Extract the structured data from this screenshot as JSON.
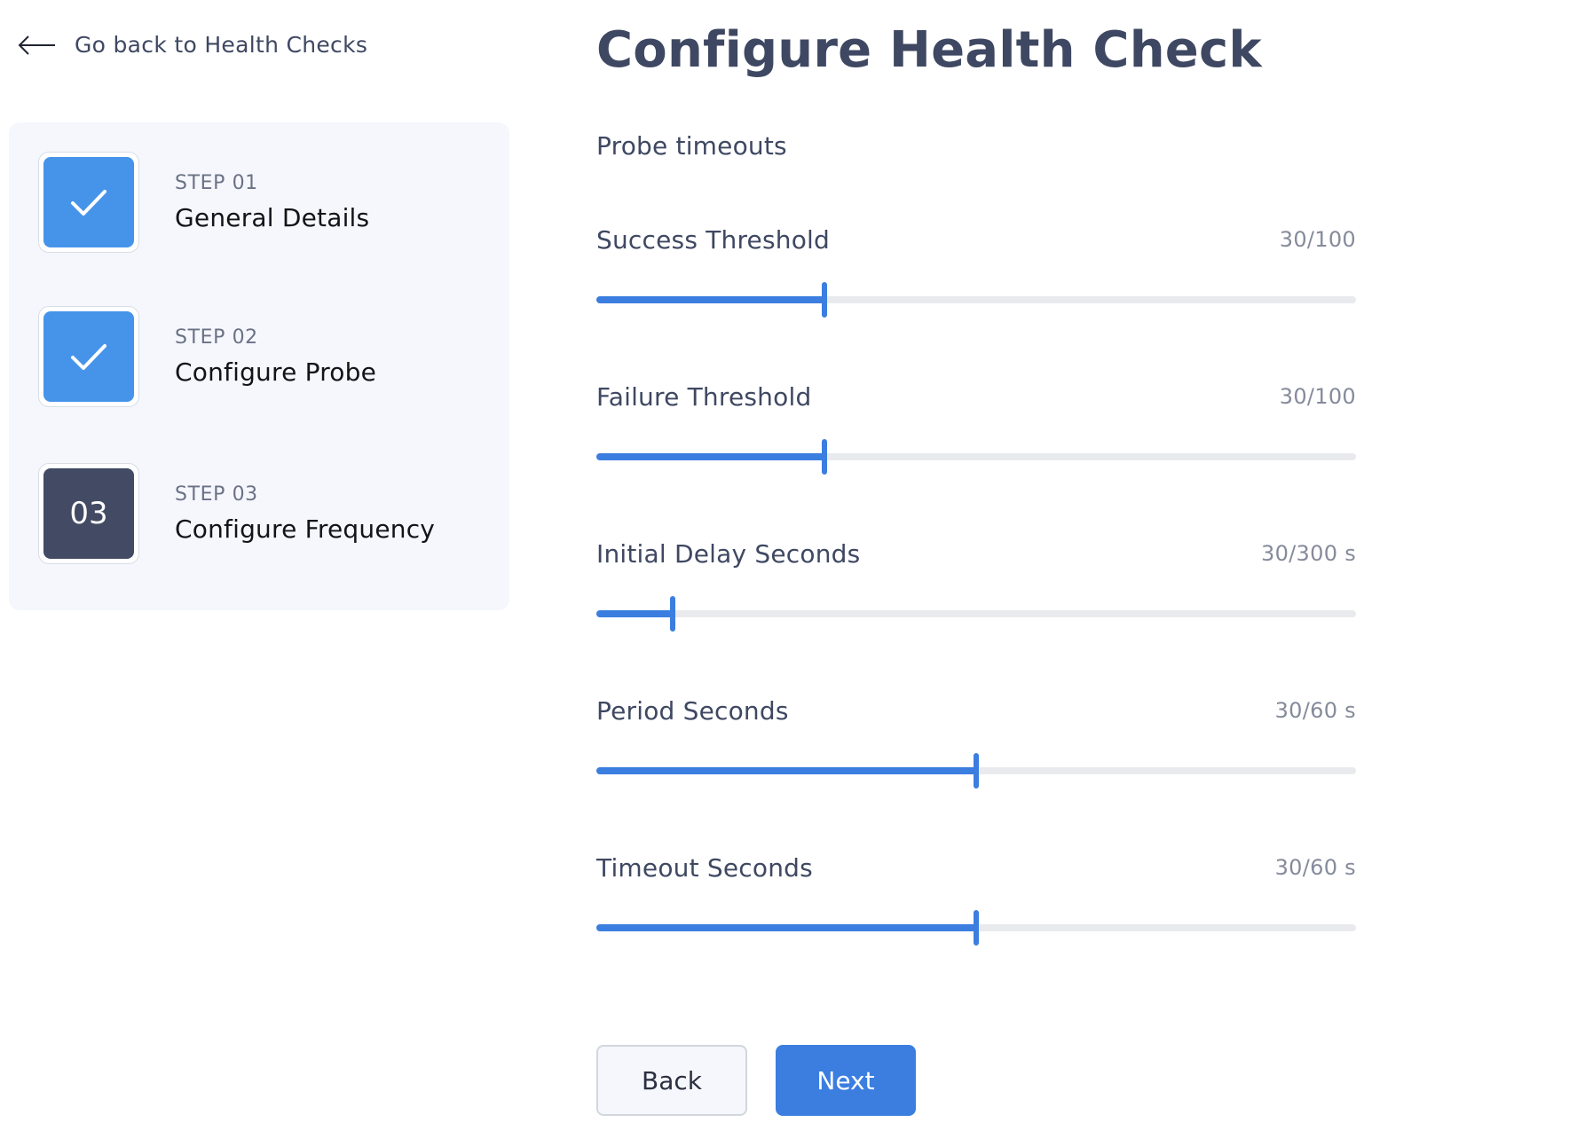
{
  "back_link": {
    "label": "Go back to Health Checks",
    "icon": "arrow-left-icon"
  },
  "steps": [
    {
      "number": "STEP 01",
      "title": "General Details",
      "status": "completed",
      "badge_text": "",
      "icon": "check-icon"
    },
    {
      "number": "STEP 02",
      "title": "Configure Probe",
      "status": "completed",
      "badge_text": "",
      "icon": "check-icon"
    },
    {
      "number": "STEP 03",
      "title": "Configure Frequency",
      "status": "current",
      "badge_text": "03",
      "icon": ""
    }
  ],
  "main": {
    "title": "Configure Health Check",
    "section_title": "Probe timeouts",
    "sliders": [
      {
        "label": "Success Threshold",
        "value": 30,
        "max": 100,
        "display": "30/100"
      },
      {
        "label": "Failure Threshold",
        "value": 30,
        "max": 100,
        "display": "30/100"
      },
      {
        "label": "Initial Delay Seconds",
        "value": 30,
        "max": 300,
        "display": "30/300 s"
      },
      {
        "label": "Period Seconds",
        "value": 30,
        "max": 60,
        "display": "30/60 s"
      },
      {
        "label": "Timeout Seconds",
        "value": 30,
        "max": 60,
        "display": "30/60 s"
      }
    ]
  },
  "buttons": {
    "back_label": "Back",
    "next_label": "Next"
  },
  "colors": {
    "accent": "#3b7ee0",
    "step_done": "#4694ea",
    "step_current": "#434a63",
    "panel_bg": "#f5f7fc",
    "heading": "#3f4862"
  }
}
